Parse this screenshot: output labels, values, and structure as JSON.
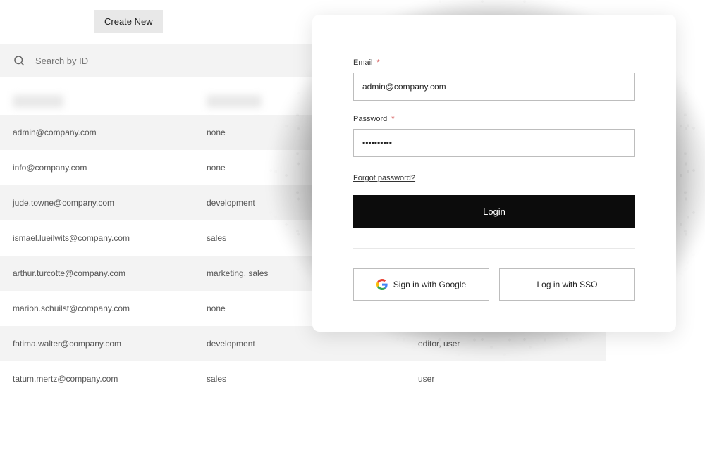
{
  "toolbar": {
    "create_label": "Create New"
  },
  "search": {
    "placeholder": "Search by ID"
  },
  "table": {
    "rows": [
      {
        "email": "admin@company.com",
        "department": "none",
        "role": ""
      },
      {
        "email": "info@company.com",
        "department": "none",
        "role": ""
      },
      {
        "email": "jude.towne@company.com",
        "department": "development",
        "role": ""
      },
      {
        "email": "ismael.lueilwits@company.com",
        "department": "sales",
        "role": ""
      },
      {
        "email": "arthur.turcotte@company.com",
        "department": "marketing, sales",
        "role": ""
      },
      {
        "email": "marion.schuilst@company.com",
        "department": "none",
        "role": ""
      },
      {
        "email": "fatima.walter@company.com",
        "department": "development",
        "role": "editor, user"
      },
      {
        "email": "tatum.mertz@company.com",
        "department": "sales",
        "role": "user"
      }
    ]
  },
  "login": {
    "email_label": "Email",
    "email_value": "admin@company.com",
    "password_label": "Password",
    "password_value": "••••••••••",
    "required_mark": "*",
    "forgot_label": "Forgot password?",
    "login_button": "Login",
    "google_label": "Sign in with Google",
    "sso_label": "Log in with SSO"
  }
}
